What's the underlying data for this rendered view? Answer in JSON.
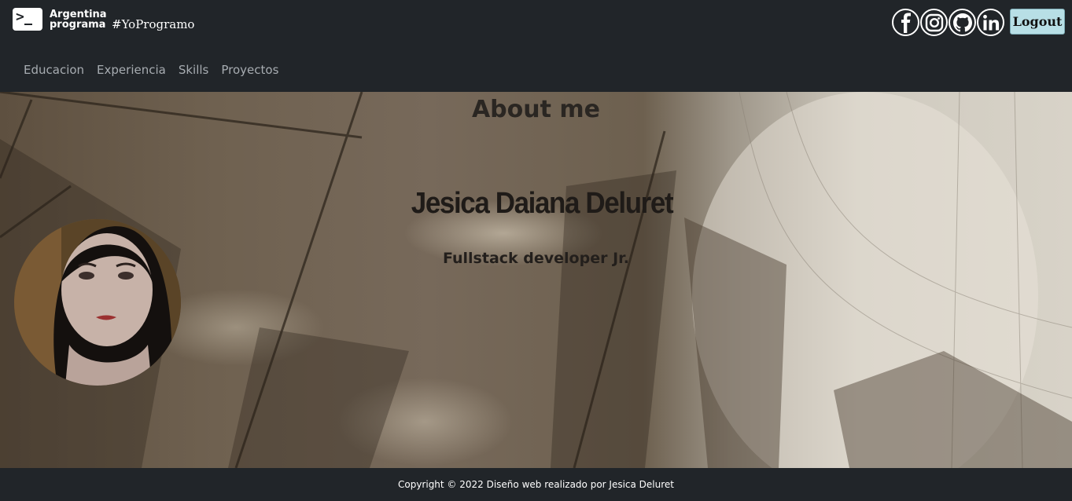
{
  "brand": {
    "logo_line1": "Argentina",
    "logo_line2": "programa",
    "hashtag": "#YoProgramo"
  },
  "header": {
    "social_icons": [
      "facebook-icon",
      "instagram-icon",
      "github-icon",
      "linkedin-icon"
    ],
    "logout_label": "Logout",
    "logout_color": "#b8dfe6"
  },
  "nav": {
    "items": [
      "Educacion",
      "Experiencia",
      "Skills",
      "Proyectos"
    ]
  },
  "about": {
    "title": "About me",
    "name": "Jesica Daiana Deluret",
    "role": "Fullstack developer Jr."
  },
  "footer": {
    "copyright": "Copyright © 2022 Diseño web realizado por Jesica Deluret"
  },
  "colors": {
    "header_bg": "#212529",
    "nav_text": "#a7acb1"
  }
}
